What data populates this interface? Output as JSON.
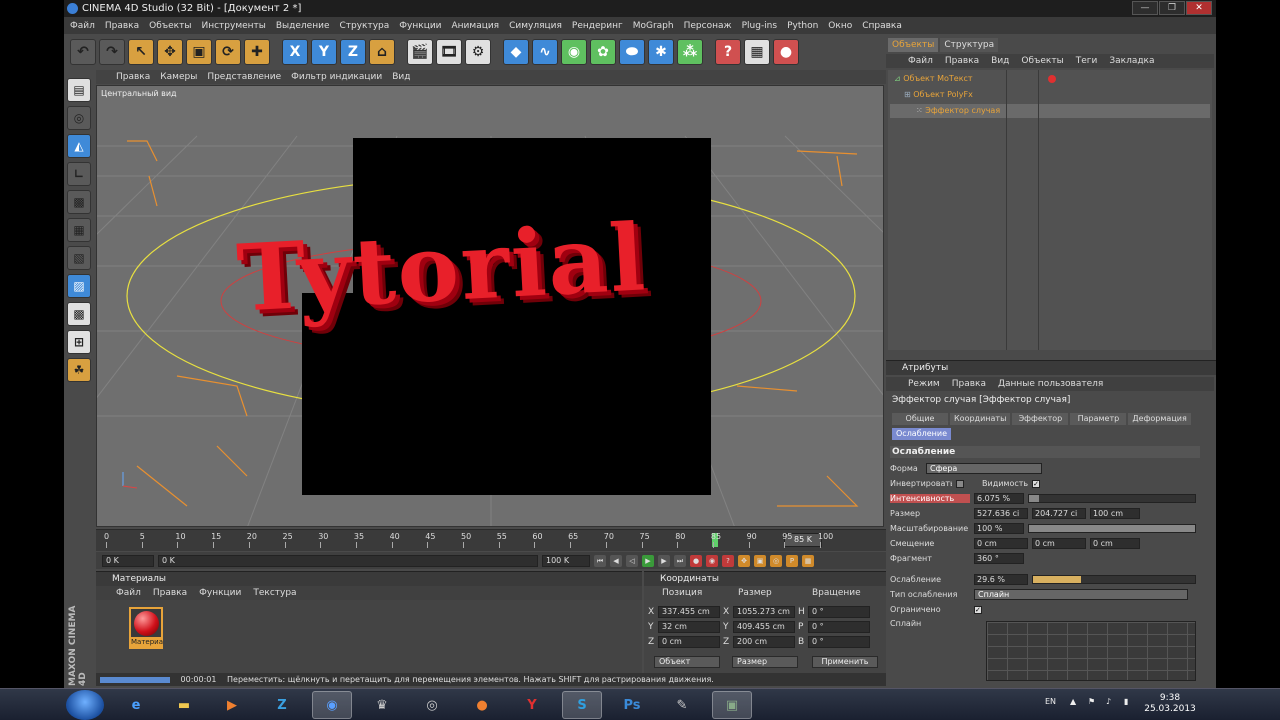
{
  "window": {
    "title": "CINEMA 4D Studio (32 Bit) - [Документ 2 *]",
    "min": "—",
    "max": "❐",
    "close": "✕"
  },
  "menu": [
    "Файл",
    "Правка",
    "Объекты",
    "Инструменты",
    "Выделение",
    "Структура",
    "Функции",
    "Анимация",
    "Симуляция",
    "Рендеринг",
    "MoGraph",
    "Персонаж",
    "Plug-ins",
    "Python",
    "Окно",
    "Справка"
  ],
  "toolbar": {
    "x": "X",
    "y": "Y",
    "z": "Z"
  },
  "viewport": {
    "menu": [
      "Правка",
      "Камеры",
      "Представление",
      "Фильтр индикации",
      "Вид"
    ],
    "label": "Центральный вид",
    "text3d": "Tytorial"
  },
  "timeline": {
    "ticks": [
      "0",
      "5",
      "10",
      "15",
      "20",
      "25",
      "30",
      "35",
      "40",
      "45",
      "50",
      "55",
      "60",
      "65",
      "70",
      "75",
      "80",
      "85",
      "90",
      "95",
      "100"
    ],
    "frame_display": "85 K",
    "start": "0 K",
    "start2": "0 K",
    "end": "100 K",
    "end2": "100 K"
  },
  "materials": {
    "title": "Материалы",
    "menu": [
      "Файл",
      "Правка",
      "Функции",
      "Текстура"
    ],
    "item": "Материа"
  },
  "coords": {
    "title": "Координаты",
    "headers": [
      "Позиция",
      "Размер",
      "Вращение"
    ],
    "rows": [
      {
        "a1": "X",
        "v1": "337.455 cm",
        "a2": "X",
        "v2": "1055.273 cm",
        "a3": "H",
        "v3": "0 °"
      },
      {
        "a1": "Y",
        "v1": "32 cm",
        "a2": "Y",
        "v2": "409.455 cm",
        "a3": "P",
        "v3": "0 °"
      },
      {
        "a1": "Z",
        "v1": "0 cm",
        "a2": "Z",
        "v2": "200 cm",
        "a3": "B",
        "v3": "0 °"
      }
    ],
    "mode1": "Объект",
    "mode2": "Размер",
    "apply": "Применить"
  },
  "objects": {
    "tabs": [
      "Объекты",
      "Структура"
    ],
    "menu": [
      "Файл",
      "Правка",
      "Вид",
      "Объекты",
      "Теги",
      "Закладка"
    ],
    "items": [
      {
        "name": "Объект MoТекст"
      },
      {
        "name": "Объект PolyFx"
      },
      {
        "name": "Эффектор случая"
      }
    ]
  },
  "attributes": {
    "title": "Атрибуты",
    "menu": [
      "Режим",
      "Правка",
      "Данные пользователя"
    ],
    "object": "Эффектор случая [Эффектор случая]",
    "tabs": [
      "Общие",
      "Координаты",
      "Эффектор",
      "Параметр",
      "Деформация"
    ],
    "tab2": "Ослабление",
    "section": "Ослабление",
    "form_label": "Форма",
    "form_value": "Сфера",
    "invert_label": "Инвертировать",
    "visibility_label": "Видимость",
    "intensity_label": "Интенсивность",
    "intensity_value": "6.075 %",
    "intensity_fraction": 0.06,
    "size_label": "Размер",
    "size_values": [
      "527.636 сі",
      "204.727 сі",
      "100 cm"
    ],
    "scale_label": "Масштабирование",
    "scale_value": "100 %",
    "scale_fraction": 1.0,
    "offset_label": "Смещение",
    "offset_values": [
      "0 cm",
      "0 cm",
      "0 cm"
    ],
    "fragment_label": "Фрагмент",
    "fragment_value": "360 °",
    "falloff_label": "Ослабление",
    "falloff_value": "29.6 %",
    "falloff_fraction": 0.296,
    "falloff_type_label": "Тип ослабления",
    "falloff_type_value": "Сплайн",
    "limited_label": "Ограничено",
    "spline_label": "Сплайн"
  },
  "status": {
    "time": "00:00:01",
    "text": "Переместить: щёлкнуть и перетащить для перемещения элементов. Нажать SHIFT для растрирования движения."
  },
  "branding": "MAXON CINEMA 4D",
  "taskbar": {
    "lang": "EN",
    "time": "9:38",
    "date": "25.03.2013"
  }
}
